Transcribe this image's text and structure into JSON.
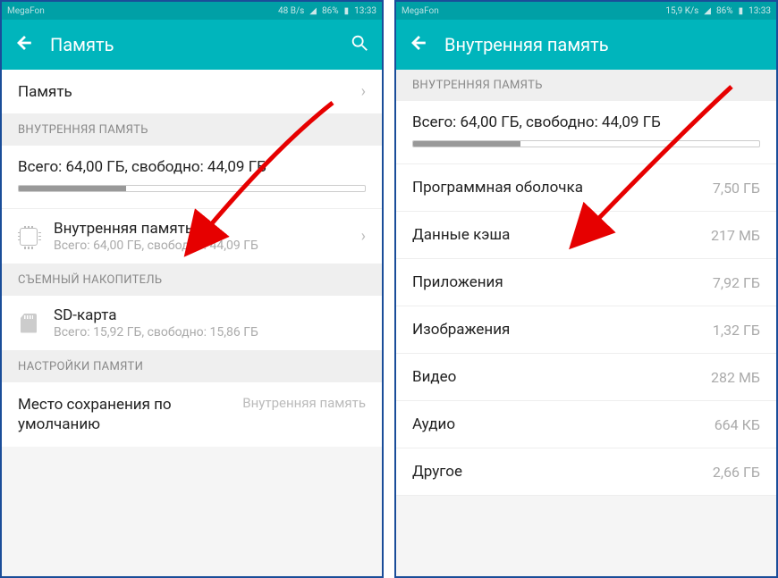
{
  "left": {
    "status": {
      "carrier": "MegaFon",
      "speed": "48 B/s",
      "battery": "86%",
      "time": "13:33"
    },
    "title": "Память",
    "memory_row": "Память",
    "internal_header": "ВНУТРЕННЯЯ ПАМЯТЬ",
    "summary": "Всего: 64,00 ГБ, свободно: 44,09 ГБ",
    "fill_pct": 31,
    "internal_item": {
      "title": "Внутренняя память",
      "sub": "Всего: 64,00 ГБ, свободно: 44,09 ГБ"
    },
    "removable_header": "СЪЕМНЫЙ НАКОПИТЕЛЬ",
    "sd_item": {
      "title": "SD-карта",
      "sub": "Всего: 15,92 ГБ, свободно: 15,86 ГБ"
    },
    "settings_header": "НАСТРОЙКИ ПАМЯТИ",
    "save_loc": {
      "label": "Место сохранения по умолчанию",
      "value": "Внутренняя память"
    }
  },
  "right": {
    "status": {
      "carrier": "MegaFon",
      "speed": "15,9 K/s",
      "battery": "86%",
      "time": "13:33"
    },
    "title": "Внутренняя память",
    "internal_header": "ВНУТРЕННЯЯ ПАМЯТЬ",
    "summary": "Всего: 64,00 ГБ, свободно: 44,09 ГБ",
    "fill_pct": 31,
    "rows": [
      {
        "label": "Программная оболочка",
        "value": "7,50 ГБ"
      },
      {
        "label": "Данные кэша",
        "value": "217 МБ"
      },
      {
        "label": "Приложения",
        "value": "7,92 ГБ"
      },
      {
        "label": "Изображения",
        "value": "1,32 ГБ"
      },
      {
        "label": "Видео",
        "value": "282 МБ"
      },
      {
        "label": "Аудио",
        "value": "664 КБ"
      },
      {
        "label": "Другое",
        "value": "2,66 ГБ"
      }
    ]
  }
}
